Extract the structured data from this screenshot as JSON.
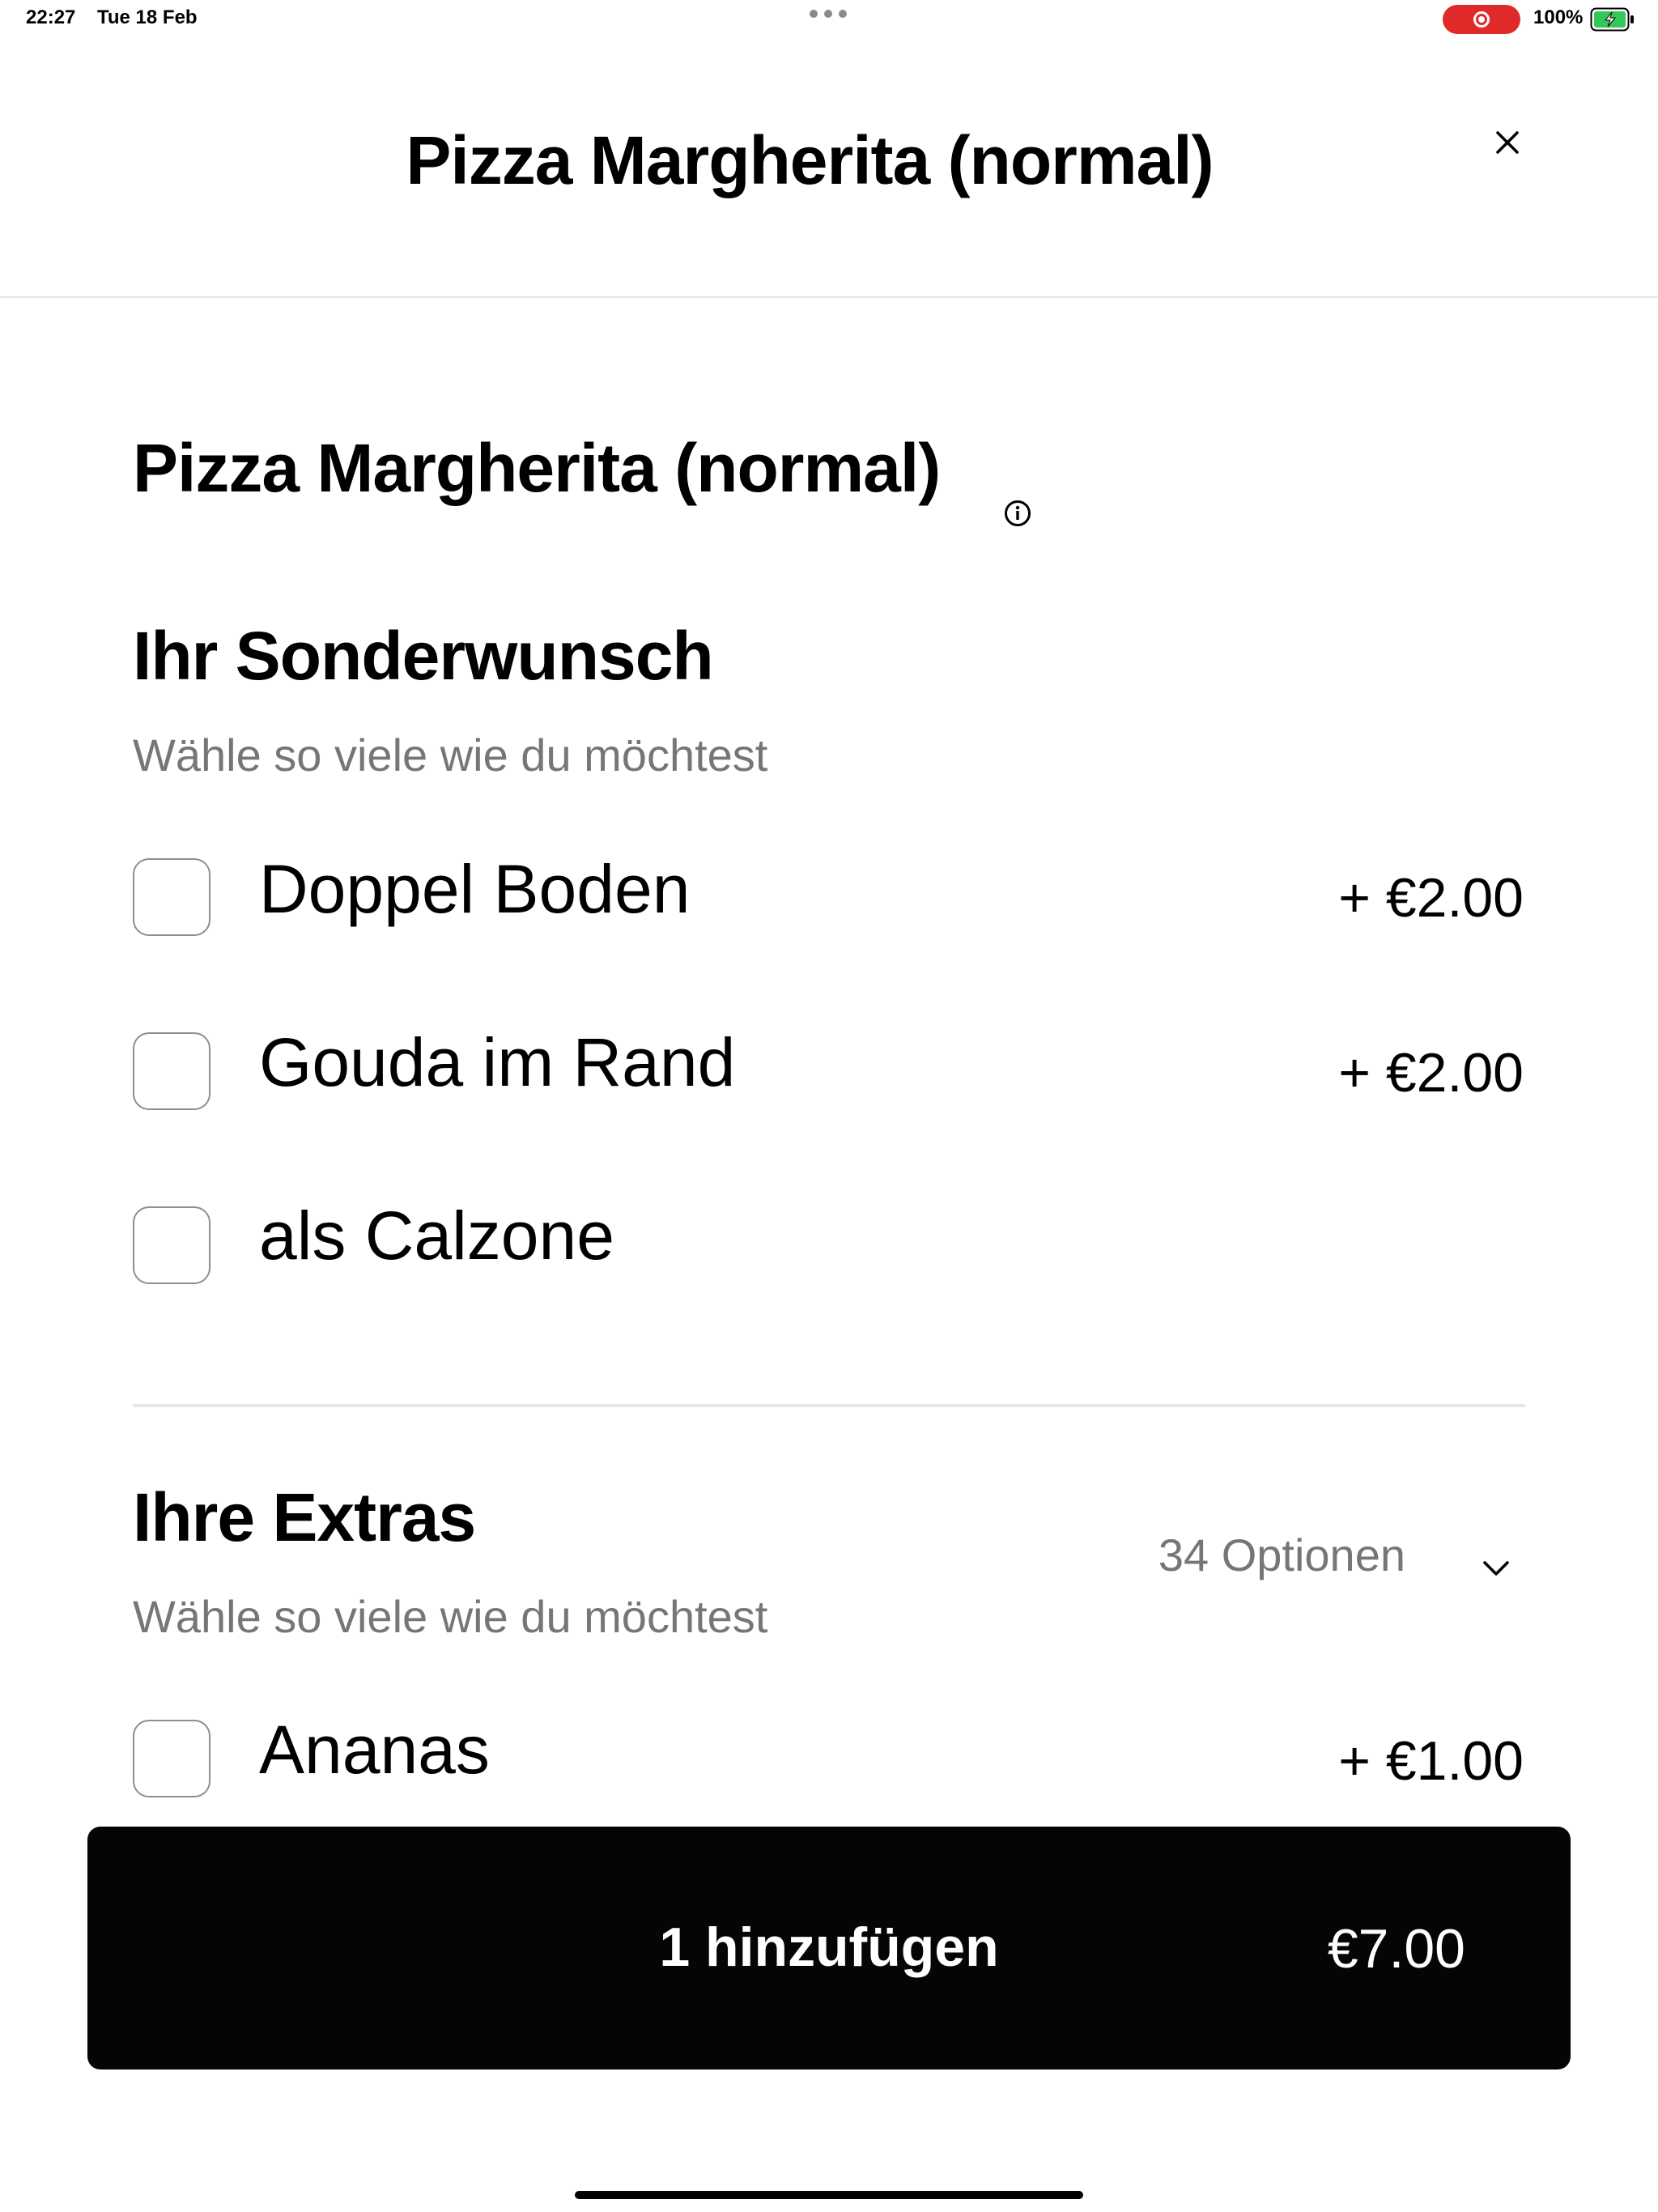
{
  "status_bar": {
    "time": "22:27",
    "date": "Tue 18 Feb",
    "battery": "100%",
    "recording_color": "#e02a2a",
    "battery_fill_color": "#34c759"
  },
  "header": {
    "title": "Pizza Margherita (normal)",
    "close_icon": "close-icon"
  },
  "item": {
    "title": "Pizza Margherita (normal)",
    "info_icon": "info-icon"
  },
  "sections": [
    {
      "title": "Ihr Sonderwunsch",
      "subtitle": "Wähle so viele wie du möchtest",
      "options": [
        {
          "label": "Doppel Boden",
          "price": "+ €2.00",
          "checked": false
        },
        {
          "label": "Gouda im Rand",
          "price": "+ €2.00",
          "checked": false
        },
        {
          "label": "als Calzone",
          "price": "",
          "checked": false
        }
      ]
    },
    {
      "title": "Ihre Extras",
      "subtitle": "Wähle so viele wie du möchtest",
      "options_count": "34 Optionen",
      "options": [
        {
          "label": "Ananas",
          "price": "+ €1.00",
          "checked": false
        }
      ]
    }
  ],
  "cta": {
    "label": "1 hinzufügen",
    "price": "€7.00",
    "background": "#050505"
  }
}
